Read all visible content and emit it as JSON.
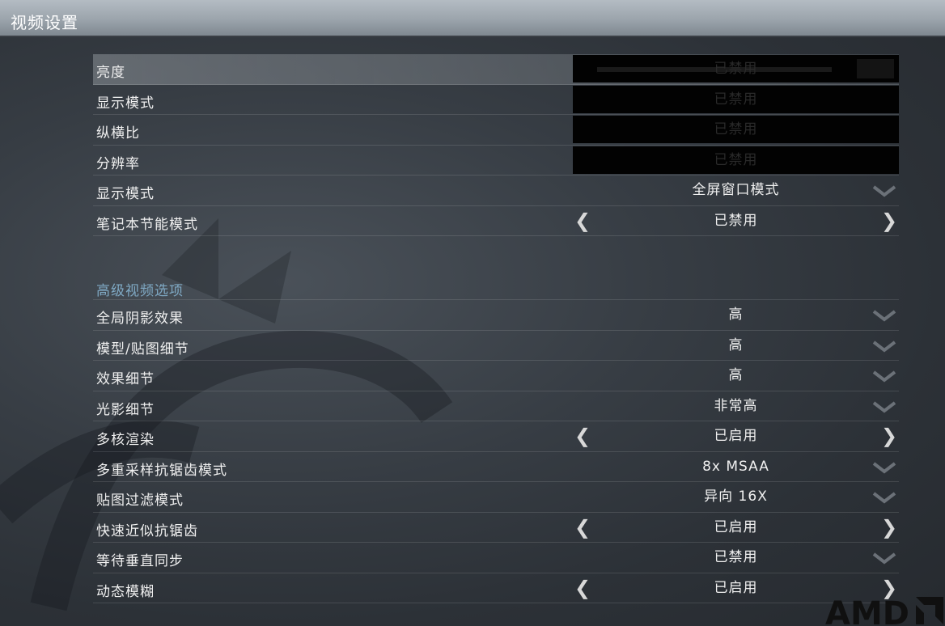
{
  "window": {
    "title": "视频设置"
  },
  "settings": [
    {
      "label": "亮度",
      "value": "已禁用",
      "control": "slider-disabled"
    },
    {
      "label": "显示模式",
      "value": "已禁用",
      "control": "disabled"
    },
    {
      "label": "纵横比",
      "value": "已禁用",
      "control": "disabled"
    },
    {
      "label": "分辨率",
      "value": "已禁用",
      "control": "disabled"
    },
    {
      "label": "显示模式",
      "value": "全屏窗口模式",
      "control": "dropdown"
    },
    {
      "label": "笔记本节能模式",
      "value": "已禁用",
      "control": "toggle"
    }
  ],
  "advanced": {
    "section_title": "高级视频选项",
    "items": [
      {
        "label": "全局阴影效果",
        "value": "高",
        "control": "dropdown"
      },
      {
        "label": "模型/贴图细节",
        "value": "高",
        "control": "dropdown"
      },
      {
        "label": "效果细节",
        "value": "高",
        "control": "dropdown"
      },
      {
        "label": "光影细节",
        "value": "非常高",
        "control": "dropdown"
      },
      {
        "label": "多核渲染",
        "value": "已启用",
        "control": "toggle"
      },
      {
        "label": "多重采样抗锯齿模式",
        "value": "8x MSAA",
        "control": "dropdown"
      },
      {
        "label": "贴图过滤模式",
        "value": "异向 16X",
        "control": "dropdown"
      },
      {
        "label": "快速近似抗锯齿",
        "value": "已启用",
        "control": "toggle"
      },
      {
        "label": "等待垂直同步",
        "value": "已禁用",
        "control": "dropdown"
      },
      {
        "label": "动态模糊",
        "value": "已启用",
        "control": "toggle"
      }
    ]
  },
  "branding": {
    "logo_text": "AMD",
    "logo_icon": "amd-arrow-icon"
  },
  "icons": {
    "dropdown": "chevron-down-icon",
    "prev": "chevron-left-icon",
    "next": "chevron-right-icon"
  },
  "colors": {
    "section_title": "#7fa9c4",
    "disabled_bg": "#020202"
  }
}
